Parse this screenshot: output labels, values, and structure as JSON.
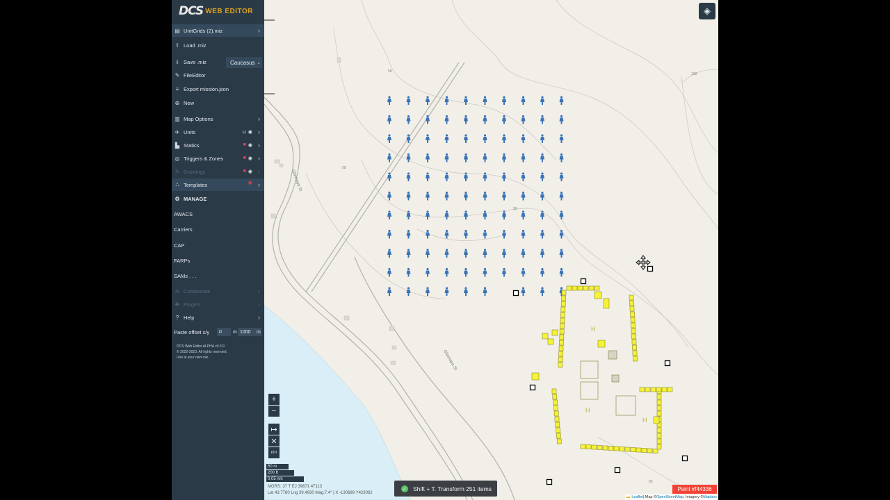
{
  "app": {
    "logo_dcs": "DCS",
    "logo_sub": "WEB EDITOR"
  },
  "menu": {
    "file": "UnitGrids (2).miz",
    "load": "Load .miz",
    "save": "Save .miz",
    "campaign": "Caucasus",
    "file_editor": "FileEditor",
    "export": "Export mission.json",
    "new": "New",
    "map_options": "Map Options",
    "units": "Units",
    "statics": "Statics",
    "triggers": "Triggers & Zones",
    "drawings": "Drawings",
    "templates": "Templates",
    "manage": "MANAGE",
    "awacs": "AWACS",
    "carriers": "Carriers",
    "cap": "CAP",
    "farps": "FARPs",
    "sams": "SAMs . . .",
    "collaborate": "Collaborate",
    "plugins": "Plugins",
    "help": "Help",
    "paste_offset": "Paste offset x/y",
    "paste_x": "0",
    "paste_unit": "m",
    "paste_y": "1000",
    "paste_unit2": "m",
    "footer1": "DCS Web Editor ALPHA v0.3.9",
    "footer2": "© 2022-2023. All rights reserved.",
    "footer3": "Use at your own risk."
  },
  "map": {
    "zoom_in": "+",
    "zoom_out": "−",
    "tool_measure": "↦",
    "tool_close": "✕",
    "tool_nm": "nm",
    "scale_m": "50 m",
    "scale_ft": "200 ft",
    "scale_nm": "0.05 nm",
    "coords1": "MGRS: 37 T EJ 39671 47113",
    "coords2": "Lat 43.7780 Lng 39.4930 Mag:7.4° | X -130689 Y423062",
    "street1": "Glavnaya St",
    "street2": "Glavnaya St",
    "contour1": "198",
    "contour2": "58",
    "contour3": "58",
    "contour4": "58",
    "contour5": "58",
    "contour6": "80"
  },
  "toast": "Shift + T. Transform 251 items",
  "paint": "Paint #f44336",
  "attribution": {
    "leaflet": "Leaflet",
    "sep": " | Map © ",
    "osm": "OpenStreetMap",
    "imagery": ", Imagery © ",
    "mapbox": "Mapbox"
  },
  "colors": {
    "sidebar": "#2b3a47",
    "unit_blue": "#3a74b7",
    "static_yellow": "#f6f23a",
    "paint": "#f44336",
    "water": "#d9eef6",
    "land": "#f2efe9"
  }
}
